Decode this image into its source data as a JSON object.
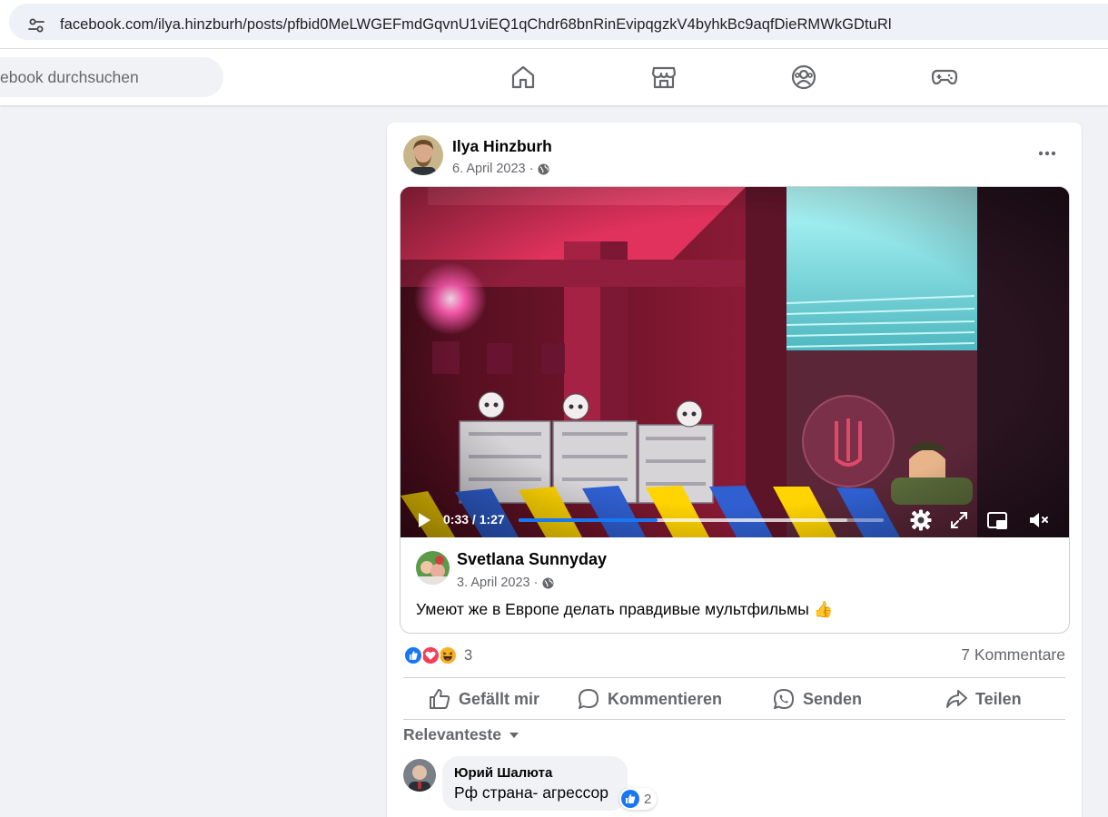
{
  "browser": {
    "url": "facebook.com/ilya.hinzburh/posts/pfbid0MeLWGEFmdGqvnU1viEQ1qChdr68bnRinEvipqgzkV4byhkBc9aqfDieRMWkGDtuRl"
  },
  "header": {
    "search_placeholder": "Facebook durchsuchen",
    "search_visible": "ebook durchsuchen",
    "nav": [
      "home-icon",
      "marketplace-icon",
      "groups-icon",
      "gaming-icon"
    ]
  },
  "post": {
    "author": "Ilya Hinzburh",
    "date": "6. April 2023 ·",
    "video": {
      "time": "0:33 / 1:27",
      "progress_fraction": 0.38,
      "buffered_fraction": 0.9
    },
    "shared": {
      "author": "Svetlana Sunnyday",
      "date": "3. April 2023 ·",
      "text": "Умеют же в Европе делать правдивые мультфильмы 👍"
    },
    "reactions": {
      "count": "3",
      "types": [
        "like",
        "love",
        "haha"
      ],
      "comments": "7 Kommentare"
    },
    "actions": {
      "like": "Gefällt mir",
      "comment": "Kommentieren",
      "send": "Senden",
      "share": "Teilen"
    },
    "sort_label": "Relevanteste",
    "comment": {
      "author": "Юрий Шалюта",
      "text": "Рф страна- агрессор",
      "likes": "2"
    }
  },
  "colors": {
    "accent": "#1877f2",
    "secondary_text": "#65676b",
    "background": "#f0f2f5"
  }
}
